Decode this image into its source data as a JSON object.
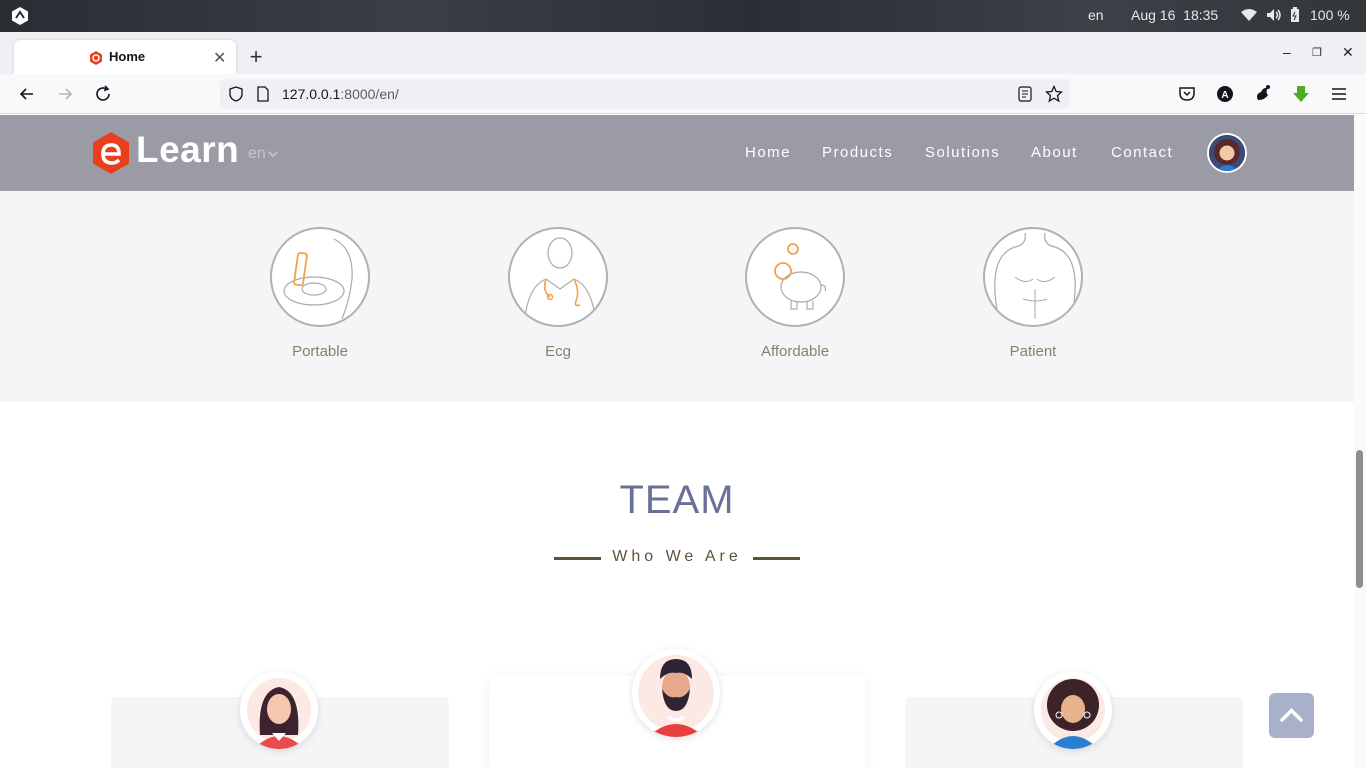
{
  "os": {
    "lang": "en",
    "date": "Aug 16",
    "time": "18:35",
    "battery": "100 %"
  },
  "browser": {
    "tab_title": "Home",
    "url_host": "127.0.0.1",
    "url_path": ":8000/en/"
  },
  "site": {
    "logo_text": "Learn",
    "lang": "en",
    "menu": [
      "Home",
      "Products",
      "Solutions",
      "About",
      "Contact"
    ],
    "features": [
      "Portable",
      "Ecg",
      "Affordable",
      "Patient"
    ],
    "team_title": "TEAM",
    "team_subtitle": "Who We Are"
  },
  "colors": {
    "header_bg": "#9a9ba4",
    "accent_orange": "#f0a34a",
    "logo_red": "#e8401c",
    "team_title": "#6b7196",
    "subtitle": "#5e5239"
  }
}
